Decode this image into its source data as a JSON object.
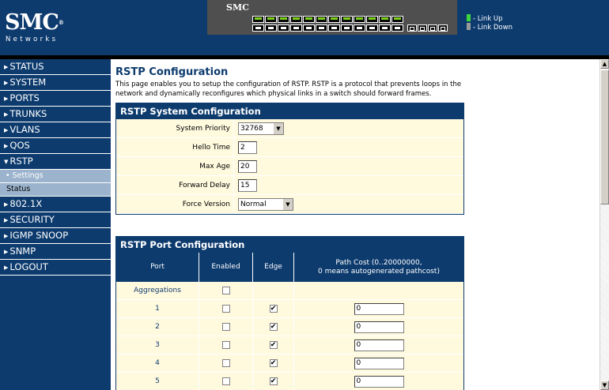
{
  "header": {
    "logo_text": "SMC",
    "logo_sub": "Networks",
    "panel_brand": "SMC",
    "legend": [
      {
        "label": "- Link Up",
        "color": "#3dd63d"
      },
      {
        "label": "- Link Down",
        "color": "#9a9a9a"
      }
    ]
  },
  "sidebar": {
    "items": [
      {
        "label": "STATUS",
        "arrow": "▶"
      },
      {
        "label": "SYSTEM",
        "arrow": "▶"
      },
      {
        "label": "PORTS",
        "arrow": "▶"
      },
      {
        "label": "TRUNKS",
        "arrow": "▶"
      },
      {
        "label": "VLANS",
        "arrow": "▶"
      },
      {
        "label": "QOS",
        "arrow": "▶"
      },
      {
        "label": "RSTP",
        "arrow": "▼"
      },
      {
        "label": "802.1X",
        "arrow": "▶"
      },
      {
        "label": "SECURITY",
        "arrow": "▶"
      },
      {
        "label": "IGMP SNOOP",
        "arrow": "▶"
      },
      {
        "label": "SNMP",
        "arrow": "▶"
      },
      {
        "label": "LOGOUT",
        "arrow": "▶"
      }
    ],
    "rstp_sub": {
      "settings": "• Settings",
      "status": "Status"
    }
  },
  "main": {
    "title": "RSTP Configuration",
    "description": "This page enables you to setup the configuration of RSTP. RSTP is a protocol that prevents loops in the network and dynamically reconfigures which physical links in a switch should forward frames.",
    "system": {
      "heading": "RSTP System Configuration",
      "system_priority_label": "System Priority",
      "system_priority_value": "32768",
      "hello_time_label": "Hello Time",
      "hello_time_value": "2",
      "max_age_label": "Max Age",
      "max_age_value": "20",
      "forward_delay_label": "Forward Delay",
      "forward_delay_value": "15",
      "force_version_label": "Force Version",
      "force_version_value": "Normal"
    },
    "ports": {
      "heading": "RSTP Port Configuration",
      "col_port": "Port",
      "col_enabled": "Enabled",
      "col_edge": "Edge",
      "col_path_cost_1": "Path Cost (0..20000000,",
      "col_path_cost_2": "0 means autogenerated pathcost)",
      "rows": [
        {
          "port": "Aggregations",
          "enabled": false,
          "edge": null,
          "path_cost": null
        },
        {
          "port": "1",
          "enabled": false,
          "edge": true,
          "path_cost": "0"
        },
        {
          "port": "2",
          "enabled": false,
          "edge": true,
          "path_cost": "0"
        },
        {
          "port": "3",
          "enabled": false,
          "edge": true,
          "path_cost": "0"
        },
        {
          "port": "4",
          "enabled": false,
          "edge": true,
          "path_cost": "0"
        },
        {
          "port": "5",
          "enabled": false,
          "edge": true,
          "path_cost": "0"
        }
      ]
    }
  }
}
